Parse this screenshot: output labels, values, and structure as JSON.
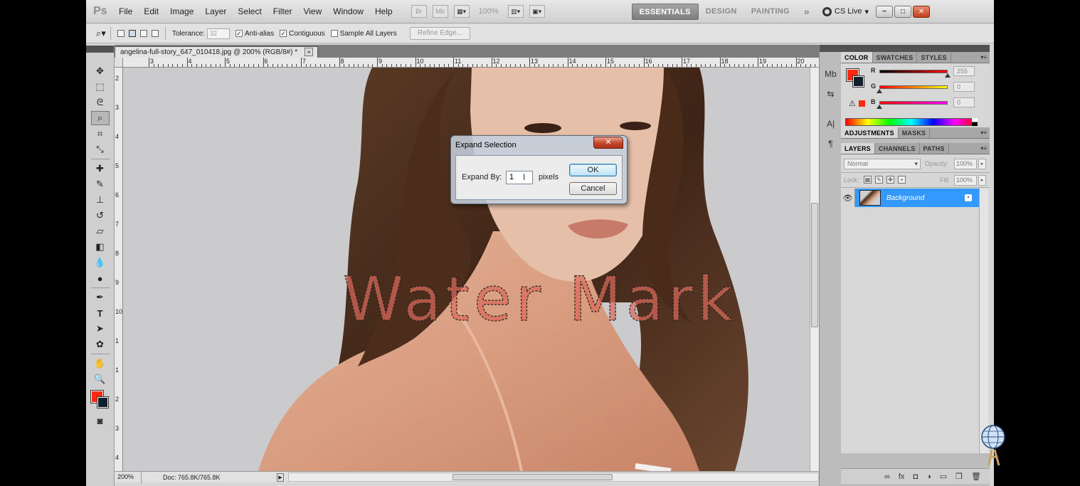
{
  "app": {
    "logo": "Ps",
    "menu": [
      "File",
      "Edit",
      "Image",
      "Layer",
      "Select",
      "Filter",
      "View",
      "Window",
      "Help"
    ],
    "zoom_level": "100%",
    "workspaces": [
      "ESSENTIALS",
      "DESIGN",
      "PAINTING"
    ],
    "active_workspace": "ESSENTIALS",
    "workspace_overflow": "»",
    "cs_live": "CS Live",
    "window_controls": [
      "−",
      "□",
      "✕"
    ]
  },
  "options_bar": {
    "tolerance_label": "Tolerance:",
    "tolerance_value": "32",
    "anti_alias_label": "Anti-alias",
    "anti_alias_checked": "✓",
    "contiguous_label": "Contiguous",
    "contiguous_checked": "✓",
    "sample_all_label": "Sample All Layers",
    "refine_edge": "Refine Edge..."
  },
  "document": {
    "tab_title": "angelina-full-story_647_010418.jpg @ 200% (RGB/8#) *",
    "close": "×",
    "ruler_h_labels": [
      "3",
      "4",
      "5",
      "6",
      "7",
      "8",
      "9",
      "10",
      "11",
      "12",
      "13",
      "14",
      "15",
      "16",
      "17",
      "18",
      "19",
      "20"
    ],
    "ruler_v_labels": [
      "2",
      "3",
      "4",
      "5",
      "6",
      "7",
      "8",
      "9",
      "10",
      "1",
      "1",
      "2",
      "3",
      "4"
    ],
    "watermark_text": "Water Mark",
    "status_zoom": "200%",
    "status_doc": "Doc: 765.8K/765.8K",
    "status_arrow": "▶"
  },
  "dialog": {
    "title": "Expand Selection",
    "close": "✕",
    "expand_label": "Expand By:",
    "expand_value": "1",
    "unit": "pixels",
    "ok": "OK",
    "cancel": "Cancel",
    "cursor": "I"
  },
  "color_panel": {
    "tabs": [
      "COLOR",
      "SWATCHES",
      "STYLES"
    ],
    "channels": [
      {
        "label": "R",
        "value": "255",
        "level": 1.0
      },
      {
        "label": "G",
        "value": "0",
        "level": 0.0
      },
      {
        "label": "B",
        "value": "0",
        "level": 0.0
      }
    ],
    "foreground": "#ff2a0f",
    "background": "#10202a"
  },
  "adjustments_panel": {
    "tabs": [
      "ADJUSTMENTS",
      "MASKS"
    ]
  },
  "layers_panel": {
    "tabs": [
      "LAYERS",
      "CHANNELS",
      "PATHS"
    ],
    "blend_mode": "Normal",
    "opacity_label": "Opacity:",
    "opacity_value": "100%",
    "lock_label": "Lock:",
    "fill_label": "Fill:",
    "fill_value": "100%",
    "layer_name": "Background"
  },
  "colors": {
    "selection_blue": "#3399ff",
    "watermark": "#d96a5a"
  }
}
